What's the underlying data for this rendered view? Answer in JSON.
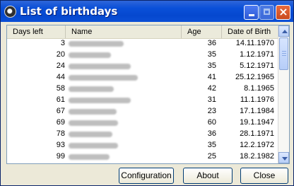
{
  "window": {
    "title": "List of birthdays"
  },
  "list": {
    "columns": [
      "Days left",
      "Name",
      "Age",
      "Date of Birth"
    ],
    "rows": [
      {
        "days": "3",
        "age": "36",
        "dob": "14.11.1970"
      },
      {
        "days": "20",
        "age": "35",
        "dob": "1.12.1971"
      },
      {
        "days": "24",
        "age": "35",
        "dob": "5.12.1971"
      },
      {
        "days": "44",
        "age": "41",
        "dob": "25.12.1965"
      },
      {
        "days": "58",
        "age": "42",
        "dob": "8.1.1965"
      },
      {
        "days": "61",
        "age": "31",
        "dob": "11.1.1976"
      },
      {
        "days": "67",
        "age": "23",
        "dob": "17.1.1984"
      },
      {
        "days": "69",
        "age": "60",
        "dob": "19.1.1947"
      },
      {
        "days": "78",
        "age": "36",
        "dob": "28.1.1971"
      },
      {
        "days": "93",
        "age": "35",
        "dob": "12.2.1972"
      },
      {
        "days": "99",
        "age": "25",
        "dob": "18.2.1982"
      }
    ]
  },
  "buttons": {
    "configuration": "Configuration",
    "about": "About",
    "close": "Close"
  }
}
